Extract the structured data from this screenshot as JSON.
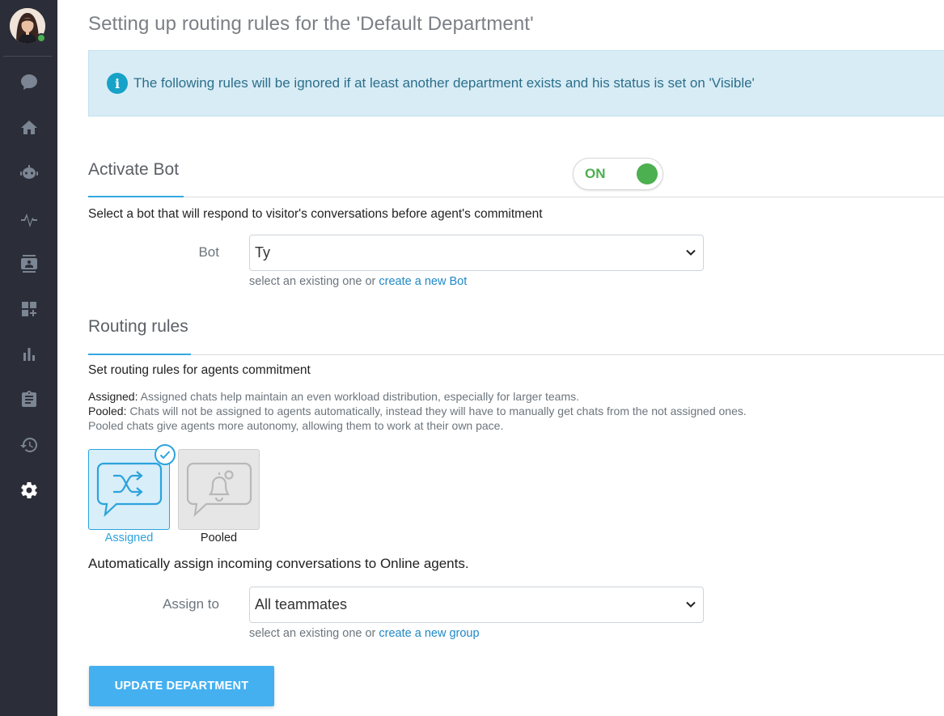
{
  "sidebar": {
    "user": {
      "online": true,
      "status_color": "#4caf50"
    },
    "items": [
      {
        "name": "chat-icon",
        "active": false
      },
      {
        "name": "home-icon",
        "active": false
      },
      {
        "name": "bot-icon",
        "active": false
      },
      {
        "name": "activity-icon",
        "active": false
      },
      {
        "name": "contacts-icon",
        "active": false
      },
      {
        "name": "apps-icon",
        "active": false
      },
      {
        "name": "reports-icon",
        "active": false
      },
      {
        "name": "tasks-icon",
        "active": false
      },
      {
        "name": "history-icon",
        "active": false
      },
      {
        "name": "gear-icon",
        "active": true
      }
    ]
  },
  "page": {
    "title": "Setting up routing rules for the 'Default Department'"
  },
  "info": {
    "text": "The following rules will be ignored if at least another department exists and his status is set on 'Visible'"
  },
  "activate_bot": {
    "title": "Activate Bot",
    "toggle_label": "ON",
    "toggle_on": true,
    "description": "Select a bot that will respond to visitor's conversations before agent's commitment",
    "field_label": "Bot",
    "selected": "Ty",
    "helper_prefix": "select an existing one or",
    "helper_link": "create a new Bot"
  },
  "routing": {
    "title": "Routing rules",
    "description": "Set routing rules for agents commitment",
    "assigned_term": "Assigned:",
    "assigned_text": "Assigned chats help maintain an even workload distribution, especially for larger teams.",
    "pooled_term": "Pooled:",
    "pooled_text": "Chats will not be assigned to agents automatically, instead they will have to manually get chats from the not assigned ones.",
    "pooled_text_2": "Pooled chats give agents more autonomy, allowing them to work at their own pace.",
    "options": [
      {
        "label": "Assigned",
        "selected": true,
        "icon": "shuffle-chat-icon"
      },
      {
        "label": "Pooled",
        "selected": false,
        "icon": "bell-chat-icon"
      }
    ],
    "auto_text": "Automatically assign incoming conversations to Online agents.",
    "assign_label": "Assign to",
    "assign_selected": "All teammates",
    "assign_helper_prefix": "select an existing one or",
    "assign_helper_link": "create a new group"
  },
  "actions": {
    "update_label": "UPDATE DEPARTMENT"
  },
  "colors": {
    "sidebar_bg": "#2b2e38",
    "accent": "#33a8e0",
    "toggle_green": "#4caf50",
    "info_bg": "#d8ecf6",
    "button": "#45b0f0"
  }
}
